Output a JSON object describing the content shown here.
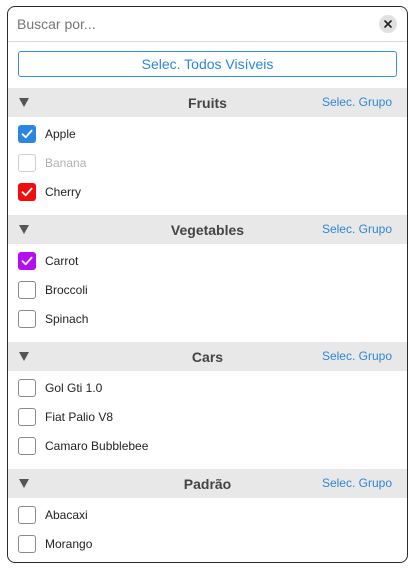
{
  "search": {
    "placeholder": "Buscar por...",
    "value": ""
  },
  "select_all_label": "Selec. Todos Visíveis",
  "groups": [
    {
      "title": "Fruits",
      "select_label": "Selec. Grupo",
      "items": [
        {
          "label": "Apple",
          "checked": true,
          "disabled": false,
          "color": "#2a86e0"
        },
        {
          "label": "Banana",
          "checked": false,
          "disabled": true,
          "color": ""
        },
        {
          "label": "Cherry",
          "checked": true,
          "disabled": false,
          "color": "#f20d0d"
        }
      ]
    },
    {
      "title": "Vegetables",
      "select_label": "Selec. Grupo",
      "items": [
        {
          "label": "Carrot",
          "checked": true,
          "disabled": false,
          "color": "#b40ff0"
        },
        {
          "label": "Broccoli",
          "checked": false,
          "disabled": false,
          "color": ""
        },
        {
          "label": "Spinach",
          "checked": false,
          "disabled": false,
          "color": ""
        }
      ]
    },
    {
      "title": "Cars",
      "select_label": "Selec. Grupo",
      "items": [
        {
          "label": "Gol Gti 1.0",
          "checked": false,
          "disabled": false,
          "color": ""
        },
        {
          "label": "Fiat Palio V8",
          "checked": false,
          "disabled": false,
          "color": ""
        },
        {
          "label": "Camaro Bubblebee",
          "checked": false,
          "disabled": false,
          "color": ""
        }
      ]
    },
    {
      "title": "Padrão",
      "select_label": "Selec. Grupo",
      "items": [
        {
          "label": "Abacaxi",
          "checked": false,
          "disabled": false,
          "color": ""
        },
        {
          "label": "Morango",
          "checked": false,
          "disabled": false,
          "color": ""
        }
      ]
    }
  ]
}
